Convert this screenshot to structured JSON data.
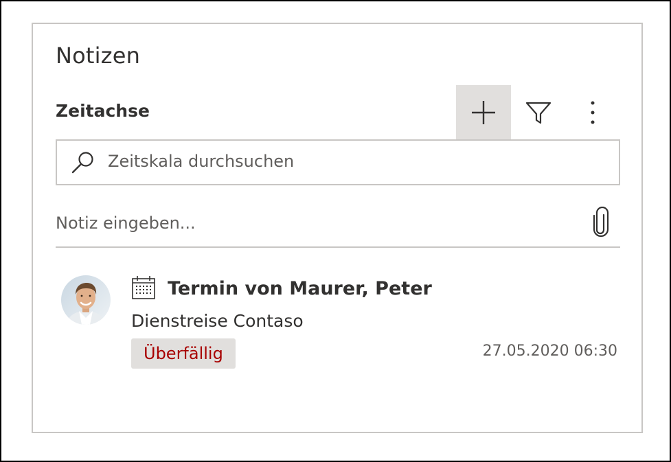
{
  "notes_panel": {
    "title": "Notizen",
    "section_title": "Zeitachse",
    "toolbar": {
      "add_icon": "plus-icon",
      "filter_icon": "filter-icon",
      "more_icon": "more-vertical-icon"
    },
    "search": {
      "placeholder": "Zeitskala durchsuchen",
      "value": "",
      "icon": "search-icon"
    },
    "note_input": {
      "placeholder": "Notiz eingeben...",
      "value": "",
      "attach_icon": "paperclip-icon"
    },
    "timeline": [
      {
        "type_icon": "calendar-icon",
        "title": "Termin von Maurer, Peter",
        "subtitle": "Dienstreise Contaso",
        "status": "Überfällig",
        "datetime": "27.05.2020 06:30"
      }
    ]
  },
  "colors": {
    "active_button_bg": "#e1dfdd",
    "border": "#c8c6c4",
    "status_text": "#a80000",
    "badge_bg": "#e1dfdd",
    "text_primary": "#323130",
    "text_secondary": "#605e5c"
  }
}
